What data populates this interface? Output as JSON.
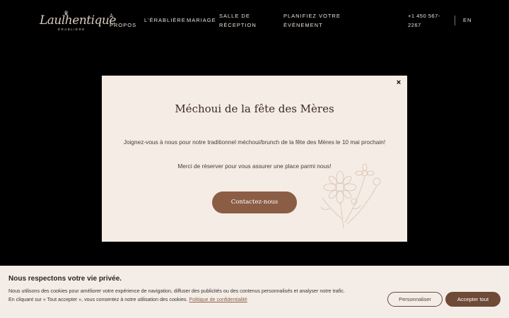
{
  "header": {
    "logo_text": "Laulhentique",
    "logo_sub": "ÉRABLIÈRE",
    "nav": {
      "apropos": "À PROPOS",
      "erabliere": "L'ÉRABLIÈRE",
      "mariage": "MARIAGE",
      "salle": "SALLE DE RÉCEPTION",
      "planifiez": "PLANIFIEZ VOTRE ÉVÉNEMENT",
      "phone": "+1 450 567-2267",
      "lang": "EN"
    }
  },
  "modal": {
    "title": "Méchoui de la fête des Mères",
    "text1": "Joignez-vous à nous pour notre traditionnel méchoui/brunch de la fête des Mères le 10 mai prochain!",
    "text2": "Merci de réserver pour vous assurer une place parmi nous!",
    "button": "Contactez-nous",
    "close": "×"
  },
  "cookie": {
    "title": "Nous respectons votre vie privée.",
    "text1": "Nous utilisons des cookies pour améliorer votre expérience de navigation, diffuser des publicités ou des contenus personnalisés et analyser notre trafic.",
    "text2": "En cliquant sur « Tout accepter », vous consentez à notre utilisation des cookies.",
    "link": "Politique de confidentialité",
    "btn_customize": "Personnaliser",
    "btn_accept": "Accepter tout"
  },
  "colors": {
    "background": "#000000",
    "modal_bg": "#f5ece5",
    "accent": "#8b5d44",
    "cookie_bg": "#f4ede7"
  }
}
